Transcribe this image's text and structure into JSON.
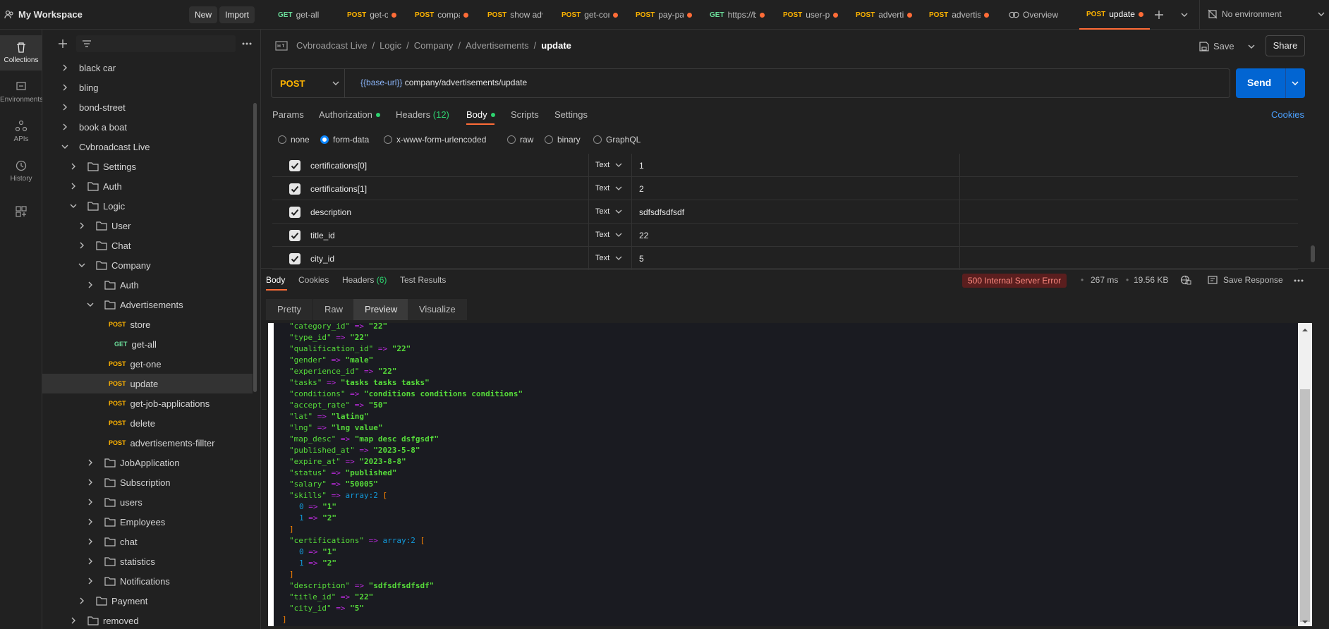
{
  "workspace": {
    "title": "My Workspace",
    "new_label": "New",
    "import_label": "Import"
  },
  "tabs": [
    {
      "method": "GET",
      "label": "get-all",
      "dot": false
    },
    {
      "method": "POST",
      "label": "get-one",
      "dot": true
    },
    {
      "method": "POST",
      "label": "company",
      "dot": true
    },
    {
      "method": "POST",
      "label": "show adv",
      "dot": false
    },
    {
      "method": "POST",
      "label": "get-comp",
      "dot": true
    },
    {
      "method": "POST",
      "label": "pay-pack",
      "dot": true
    },
    {
      "method": "GET",
      "label": "https://ba",
      "dot": true
    },
    {
      "method": "POST",
      "label": "user-prof",
      "dot": true
    },
    {
      "method": "POST",
      "label": "advertis",
      "dot": true
    },
    {
      "method": "POST",
      "label": "advertis",
      "dot": true
    }
  ],
  "overview_label": "Overview",
  "active_tab": {
    "method": "POST",
    "label": "update"
  },
  "environment": "No environment",
  "rail": [
    {
      "label": "Collections",
      "icon": "trash-icon"
    },
    {
      "label": "Environments",
      "icon": "environment-icon"
    },
    {
      "label": "APIs",
      "icon": "apis-icon"
    },
    {
      "label": "History",
      "icon": "history-icon"
    }
  ],
  "tree": {
    "black_car": "black car",
    "bling": "bling",
    "bond_street": "bond-street",
    "book_a_boat": "book a boat",
    "cvbroadcast": "Cvbroadcast Live",
    "settings": "Settings",
    "auth": "Auth",
    "logic": "Logic",
    "user": "User",
    "chat": "Chat",
    "company": "Company",
    "company_auth": "Auth",
    "advertisements": "Advertisements",
    "req_store": "store",
    "req_get_all": "get-all",
    "req_get_one": "get-one",
    "req_update": "update",
    "req_get_job": "get-job-applications",
    "req_delete": "delete",
    "req_filter": "advertisements-fillter",
    "job_application": "JobApplication",
    "subscription": "Subscription",
    "users": "users",
    "employees": "Employees",
    "chat2": "chat",
    "statistics": "statistics",
    "notifications": "Notifications",
    "payment": "Payment",
    "removed": "removed",
    "post": "POST",
    "get": "GET"
  },
  "breadcrumb": {
    "items": [
      "Cvbroadcast Live",
      "Logic",
      "Company",
      "Advertisements"
    ],
    "current": "update",
    "sep": "/"
  },
  "toolbar": {
    "save_label": "Save",
    "share_label": "Share"
  },
  "request": {
    "method": "POST",
    "url_var": "{{base-url}}",
    "url_path": " company/advertisements/update",
    "send_label": "Send"
  },
  "request_tabs": {
    "params": "Params",
    "authorization": "Authorization",
    "headers": "Headers",
    "headers_count": "(12)",
    "body": "Body",
    "scripts": "Scripts",
    "settings": "Settings",
    "cookies": "Cookies"
  },
  "body_modes": [
    "none",
    "form-data",
    "x-www-form-urlencoded",
    "raw",
    "binary",
    "GraphQL"
  ],
  "form_rows": [
    {
      "key": "certifications[0]",
      "type": "Text",
      "value": "1"
    },
    {
      "key": "certifications[1]",
      "type": "Text",
      "value": "2"
    },
    {
      "key": "description",
      "type": "Text",
      "value": "sdfsdfsdfsdf"
    },
    {
      "key": "title_id",
      "type": "Text",
      "value": "22"
    },
    {
      "key": "city_id",
      "type": "Text",
      "value": "5"
    }
  ],
  "response_tabs": {
    "body": "Body",
    "cookies": "Cookies",
    "headers": "Headers",
    "headers_count": "(6)",
    "test_results": "Test Results"
  },
  "response_meta": {
    "status": "500 Internal Server Error",
    "time": "267 ms",
    "size": "19.56 KB",
    "save_response": "Save Response",
    "sep": "•"
  },
  "view_tabs": [
    "Pretty",
    "Raw",
    "Preview",
    "Visualize"
  ],
  "preview_lines": [
    {
      "indent": 0,
      "k": "\"category_id\"",
      "v": "\"22\""
    },
    {
      "indent": 0,
      "k": "\"type_id\"",
      "v": "\"22\""
    },
    {
      "indent": 0,
      "k": "\"qualification_id\"",
      "v": "\"22\""
    },
    {
      "indent": 0,
      "k": "\"gender\"",
      "v": "\"male\""
    },
    {
      "indent": 0,
      "k": "\"experience_id\"",
      "v": "\"22\""
    },
    {
      "indent": 0,
      "k": "\"tasks\"",
      "v": "\"tasks tasks tasks\""
    },
    {
      "indent": 0,
      "k": "\"conditions\"",
      "v": "\"conditions conditions conditions\""
    },
    {
      "indent": 0,
      "k": "\"accept_rate\"",
      "v": "\"50\""
    },
    {
      "indent": 0,
      "k": "\"lat\"",
      "v": "\"lating\""
    },
    {
      "indent": 0,
      "k": "\"lng\"",
      "v": "\"lng value\""
    },
    {
      "indent": 0,
      "k": "\"map_desc\"",
      "v": "\"map desc dsfgsdf\""
    },
    {
      "indent": 0,
      "k": "\"published_at\"",
      "v": "\"2023-5-8\""
    },
    {
      "indent": 0,
      "k": "\"expire_at\"",
      "v": "\"2023-8-8\""
    },
    {
      "indent": 0,
      "k": "\"status\"",
      "v": "\"published\""
    },
    {
      "indent": 0,
      "k": "\"salary\"",
      "v": "\"50005\""
    },
    {
      "indent": 0,
      "k": "\"skills\"",
      "arr": "array:2",
      "open": "["
    },
    {
      "indent": 1,
      "n": "0",
      "v": "\"1\""
    },
    {
      "indent": 1,
      "n": "1",
      "v": "\"2\""
    },
    {
      "indent": 0,
      "close": "]"
    },
    {
      "indent": 0,
      "k": "\"certifications\"",
      "arr": "array:2",
      "open": "["
    },
    {
      "indent": 1,
      "n": "0",
      "v": "\"1\""
    },
    {
      "indent": 1,
      "n": "1",
      "v": "\"2\""
    },
    {
      "indent": 0,
      "close": "]"
    },
    {
      "indent": 0,
      "k": "\"description\"",
      "v": "\"sdfsdfsdfsdf\""
    },
    {
      "indent": 0,
      "k": "\"title_id\"",
      "v": "\"22\""
    },
    {
      "indent": 0,
      "k": "\"city_id\"",
      "v": "\"5\""
    },
    {
      "indent": -1,
      "close": "]"
    }
  ],
  "arrow": "=>"
}
